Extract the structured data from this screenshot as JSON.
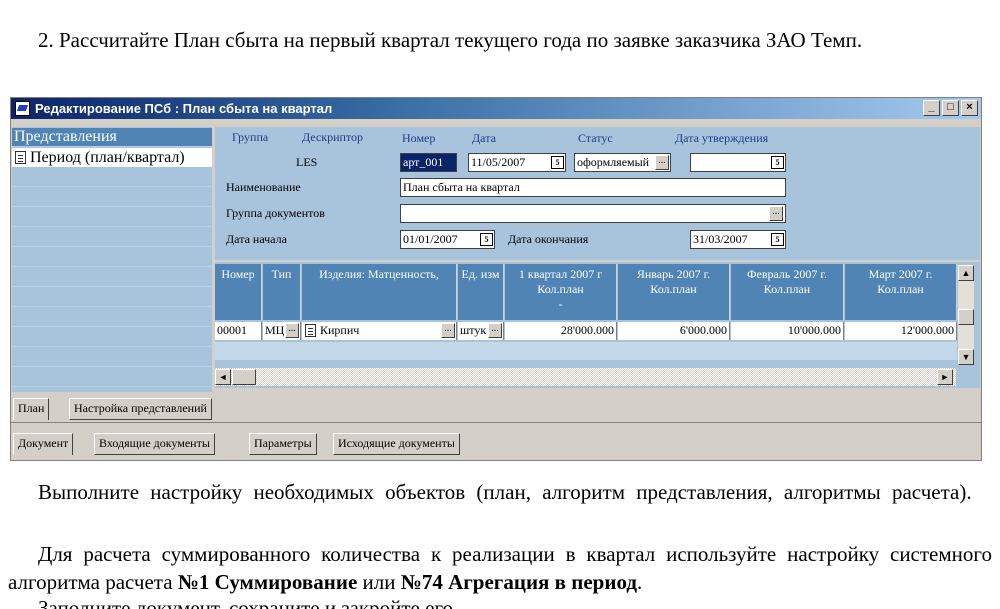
{
  "doc": {
    "top_para": "2. Рассчитайте План сбыта на первый квартал текущего года по заявке заказчика ЗАО Темп.",
    "para1": "Выполните настройку необходимых объектов (план, алгоритм представления, алгоритмы расчета).",
    "para2_a": "Для расчета суммированного количества к реализации в квартал используйте настройку системного алгоритма расчета ",
    "para2_b1": "№1 Суммирование",
    "para2_mid": " или ",
    "para2_b2": "№74 Агрегация в период",
    "para2_end": ".",
    "para3": "Заполните документ, сохраните и закройте его."
  },
  "window": {
    "title": "Редактирование ПСб : План сбыта на квартал",
    "btn_min": "_",
    "btn_max": "□",
    "btn_close": "×"
  },
  "left_panel": {
    "header": "Представления",
    "item": "Период (план/квартал)"
  },
  "form": {
    "group_label": "Группа",
    "descriptor_label": "Дескриптор",
    "number_label": "Номер",
    "date_label": "Дата",
    "status_label": "Статус",
    "approval_label": "Дата утверждения",
    "descriptor_value": "LES",
    "number_value": "арт_001",
    "date_value": "11/05/2007",
    "status_value": "оформляемый",
    "approval_value": "",
    "name_label": "Наименование",
    "name_value": "План сбыта на квартал",
    "docgroup_label": "Группа документов",
    "docgroup_value": "",
    "start_label": "Дата начала",
    "start_value": "01/01/2007",
    "end_label": "Дата окончания",
    "end_value": "31/03/2007",
    "ellipsis": "...",
    "cal": "5"
  },
  "grid": {
    "headers": [
      "Номер",
      "Тип",
      "Изделия: Матценность,",
      "Ед. изм",
      "1 квартал 2007 г. Кол.план",
      "Январь 2007 г. Кол.план",
      "Февраль 2007 г. Кол.план",
      "Март 2007 г. Кол.план"
    ],
    "h_q1_line1": "1 квартал 2007 г",
    "h_q1_line2": "Кол.план",
    "h_q1_line3": "-",
    "h_jan_line1": "Январь 2007 г.",
    "h_jan_line2": "Кол.план",
    "h_feb_line1": "Февраль 2007 г.",
    "h_feb_line2": "Кол.план",
    "h_mar_line1": "Март 2007 г.",
    "h_mar_line2": "Кол.план",
    "row": {
      "number": "00001",
      "type": "МЦ",
      "item": "Кирпич",
      "unit": "штук",
      "q1": "28'000.000",
      "jan": "6'000.000",
      "feb": "10'000.000",
      "mar": "12'000.000"
    },
    "scroll_up": "▲",
    "scroll_down": "▼",
    "scroll_left": "◄",
    "scroll_right": "►"
  },
  "tabs_top": [
    "План",
    "Настройка представлений"
  ],
  "tabs_bottom": [
    "Документ",
    "Входящие документы",
    "Параметры",
    "Исходящие документы"
  ]
}
